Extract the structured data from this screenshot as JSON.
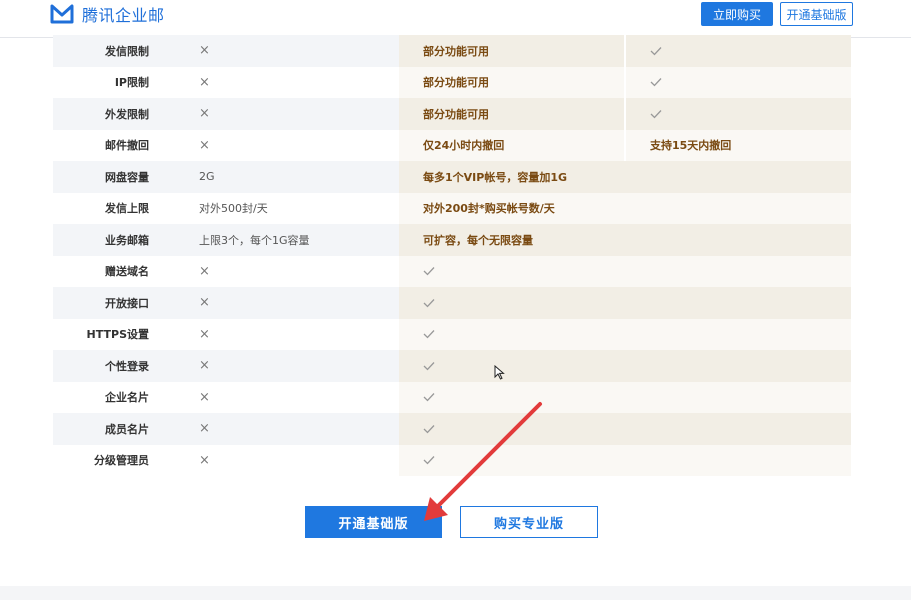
{
  "header": {
    "logo_text": "腾讯企业邮",
    "buy_now_label": "立即购买",
    "open_basic_label": "开通基础版",
    "brand_color": "#1f78e0"
  },
  "table": {
    "rows": [
      {
        "label": "发信限制",
        "basic": "×",
        "pro": "部分功能可用",
        "flag": "✓"
      },
      {
        "label": "IP限制",
        "basic": "×",
        "pro": "部分功能可用",
        "flag": "✓"
      },
      {
        "label": "外发限制",
        "basic": "×",
        "pro": "部分功能可用",
        "flag": "✓"
      },
      {
        "label": "邮件撤回",
        "basic": "×",
        "pro": "仅24小时内撤回",
        "flag": "支持15天内撤回"
      },
      {
        "label": "网盘容量",
        "basic": "2G",
        "pro": "每多1个VIP帐号，容量加1G"
      },
      {
        "label": "发信上限",
        "basic": "对外500封/天",
        "pro": "对外200封*购买帐号数/天"
      },
      {
        "label": "业务邮箱",
        "basic": "上限3个，每个1G容量",
        "pro": "可扩容，每个无限容量"
      },
      {
        "label": "赠送域名",
        "basic": "×",
        "pro": "✓"
      },
      {
        "label": "开放接口",
        "basic": "×",
        "pro": "✓"
      },
      {
        "label": "HTTPS设置",
        "basic": "×",
        "pro": "✓"
      },
      {
        "label": "个性登录",
        "basic": "×",
        "pro": "✓"
      },
      {
        "label": "企业名片",
        "basic": "×",
        "pro": "✓"
      },
      {
        "label": "成员名片",
        "basic": "×",
        "pro": "✓"
      },
      {
        "label": "分级管理员",
        "basic": "×",
        "pro": "✓"
      }
    ]
  },
  "actions": {
    "open_basic_label": "开通基础版",
    "buy_pro_label": "购买专业版"
  },
  "colors": {
    "accent": "#1f78e0",
    "pro_text": "#7a4a12",
    "pro_bg": "#f2eee5",
    "annotation_arrow": "#e23b3b"
  },
  "icons": {
    "logo": "tencent-exmail-logo-icon",
    "no": "cross-icon",
    "yes": "check-icon",
    "cursor": "mouse-pointer-icon",
    "annotation": "red-arrow-icon"
  }
}
